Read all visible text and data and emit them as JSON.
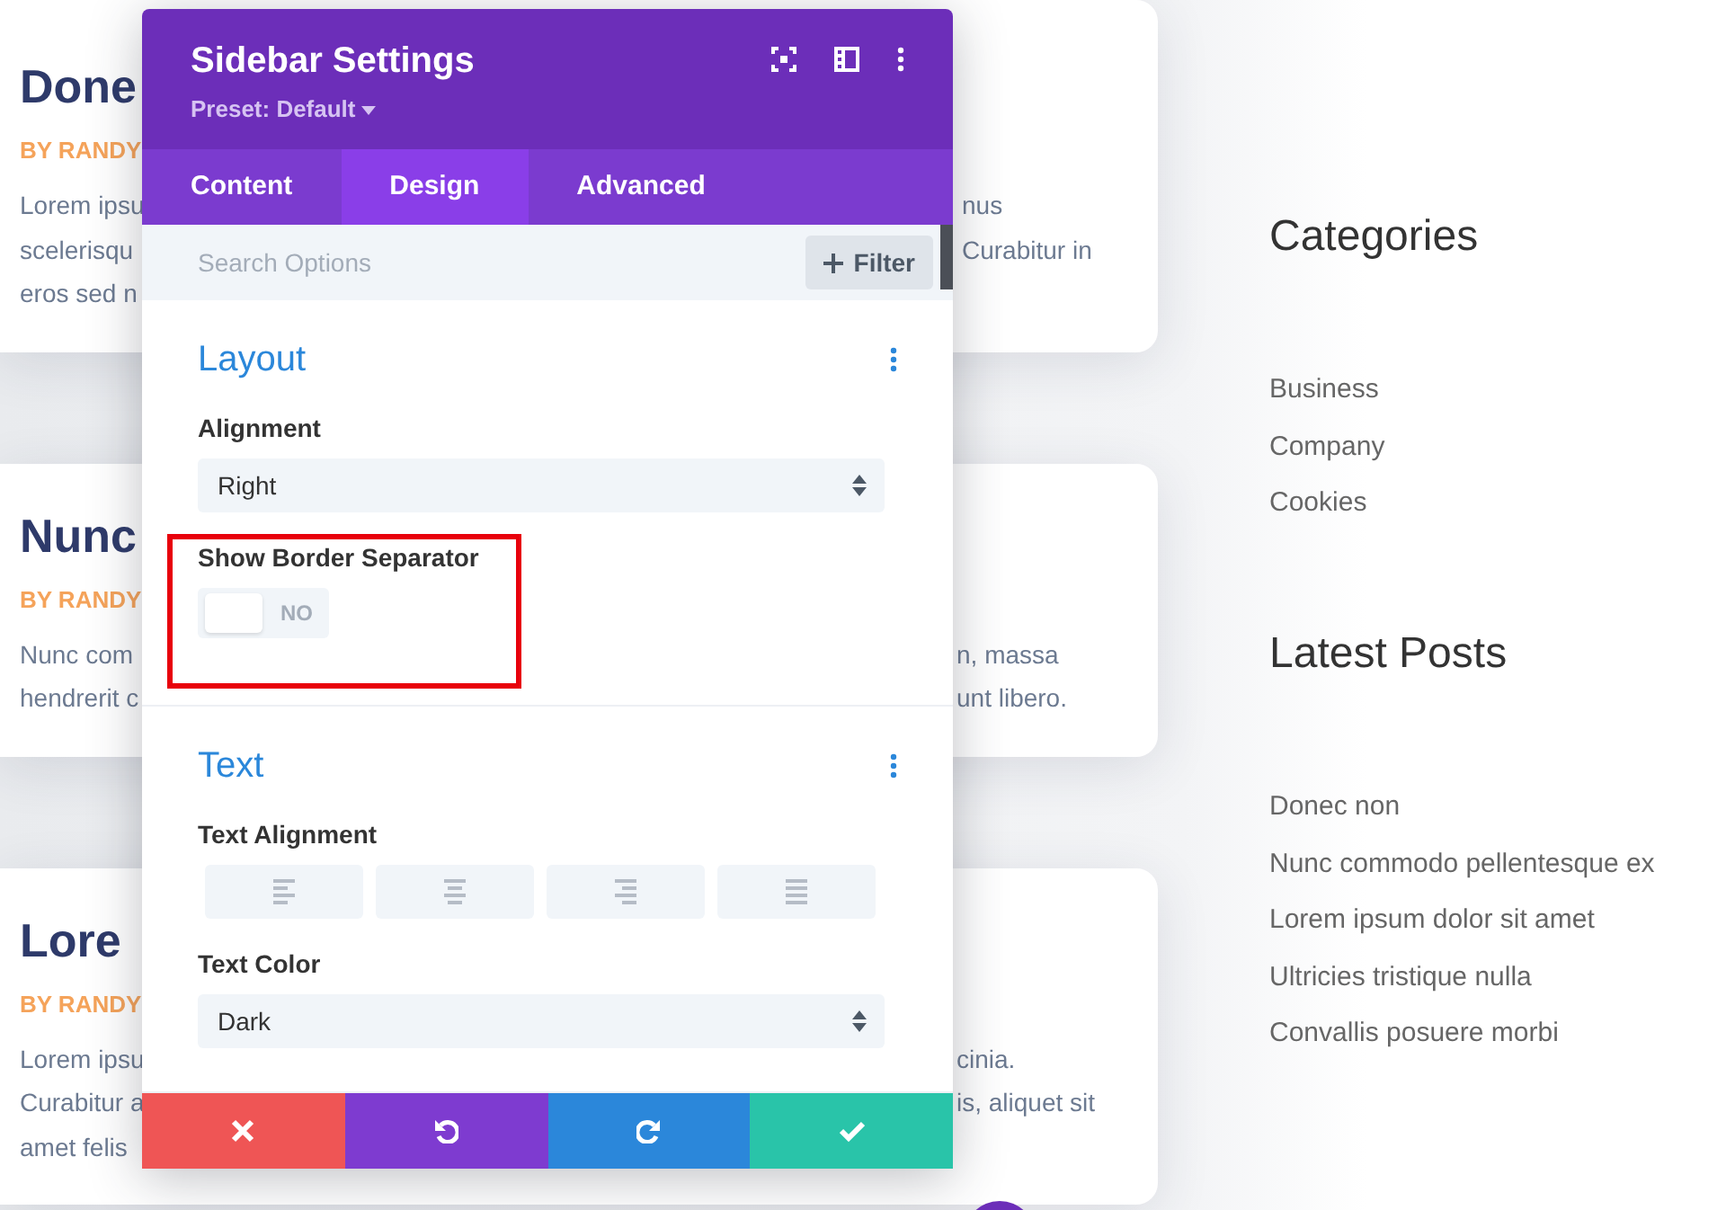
{
  "posts": [
    {
      "title": "Done",
      "author": "BY RANDY",
      "left_lines": [
        "Lorem ipsu",
        "scelerisqu",
        "eros sed n"
      ],
      "right_lines": [
        "nus",
        "Curabitur in"
      ]
    },
    {
      "title": "Nunc",
      "author": "BY RANDY",
      "left_lines": [
        "Nunc com",
        "hendrerit c"
      ],
      "right_lines": [
        "n, massa",
        "unt libero."
      ]
    },
    {
      "title": "Lore",
      "author": "BY RANDY",
      "left_lines": [
        "Lorem ipsu",
        "Curabitur a",
        "amet felis"
      ],
      "right_lines": [
        "cinia.",
        "is, aliquet sit"
      ]
    }
  ],
  "sidebar": [
    {
      "heading": "Categories",
      "items": [
        "Business",
        "Company",
        "Cookies"
      ]
    },
    {
      "heading": "Latest Posts",
      "items": [
        "Donec non",
        "Nunc commodo pellentesque ex",
        "Lorem ipsum dolor sit amet",
        "Ultricies tristique nulla",
        "Convallis posuere morbi"
      ]
    }
  ],
  "modal": {
    "title": "Sidebar Settings",
    "preset": "Preset: Default",
    "tabs": [
      {
        "label": "Content",
        "selected": false
      },
      {
        "label": "Design",
        "selected": true
      },
      {
        "label": "Advanced",
        "selected": false
      }
    ],
    "search": {
      "placeholder": "Search Options"
    },
    "filter_button": "Filter",
    "sections": [
      {
        "title": "Layout",
        "fields": [
          {
            "kind": "select",
            "label": "Alignment",
            "value": "Right"
          },
          {
            "kind": "toggle",
            "label": "Show Border Separator",
            "on": false,
            "state_text": "NO",
            "highlighted": true
          }
        ]
      },
      {
        "title": "Text",
        "fields": [
          {
            "kind": "align",
            "label": "Text Alignment"
          },
          {
            "kind": "select",
            "label": "Text Color",
            "value": "Dark"
          }
        ]
      }
    ]
  }
}
